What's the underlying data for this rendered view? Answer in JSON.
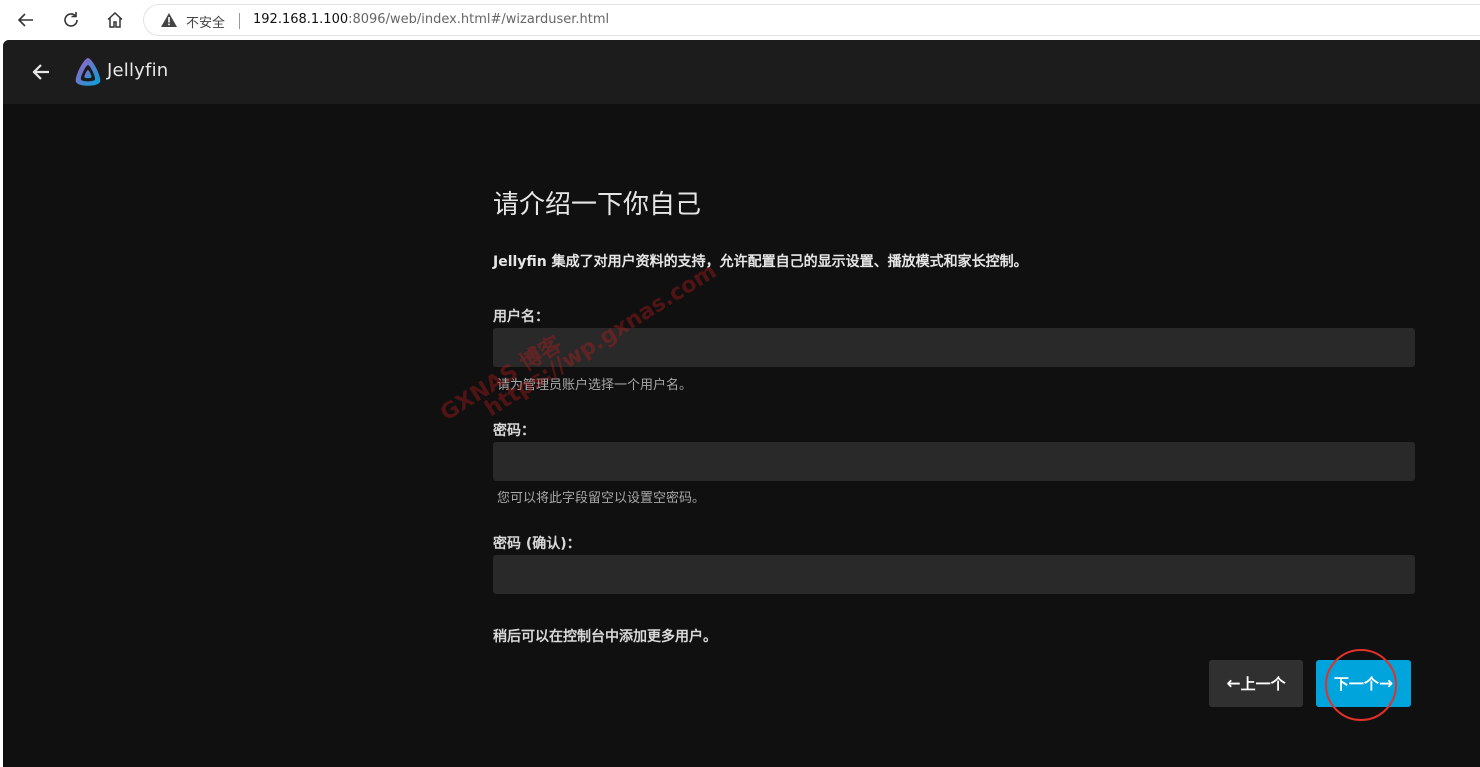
{
  "browser": {
    "insecure_label": "不安全",
    "url_host": "192.168.1.100",
    "url_rest": ":8096/web/index.html#/wizarduser.html"
  },
  "app": {
    "brand": "Jellyfin"
  },
  "wizard": {
    "title": "请介绍一下你自己",
    "intro": "Jellyfin 集成了对用户资料的支持，允许配置自己的显示设置、播放模式和家长控制。",
    "username_label": "用户名：",
    "username_value": "",
    "username_hint": "请为管理员账户选择一个用户名。",
    "password_label": "密码：",
    "password_value": "",
    "password_hint": "您可以将此字段留空以设置空密码。",
    "confirm_label": "密码 (确认)：",
    "confirm_value": "",
    "footer_note": "稍后可以在控制台中添加更多用户。",
    "prev_label": "上一个",
    "next_label": "下一个",
    "prev_arrow": "←",
    "next_arrow": "→"
  },
  "watermark": {
    "line1": "GXNAS 博客",
    "line2": "https://wp.gxnas.com"
  },
  "colors": {
    "accent": "#00a4dc",
    "background": "#101010",
    "header": "#1c1c1c",
    "input": "#292929",
    "annotation": "#e0312b"
  }
}
